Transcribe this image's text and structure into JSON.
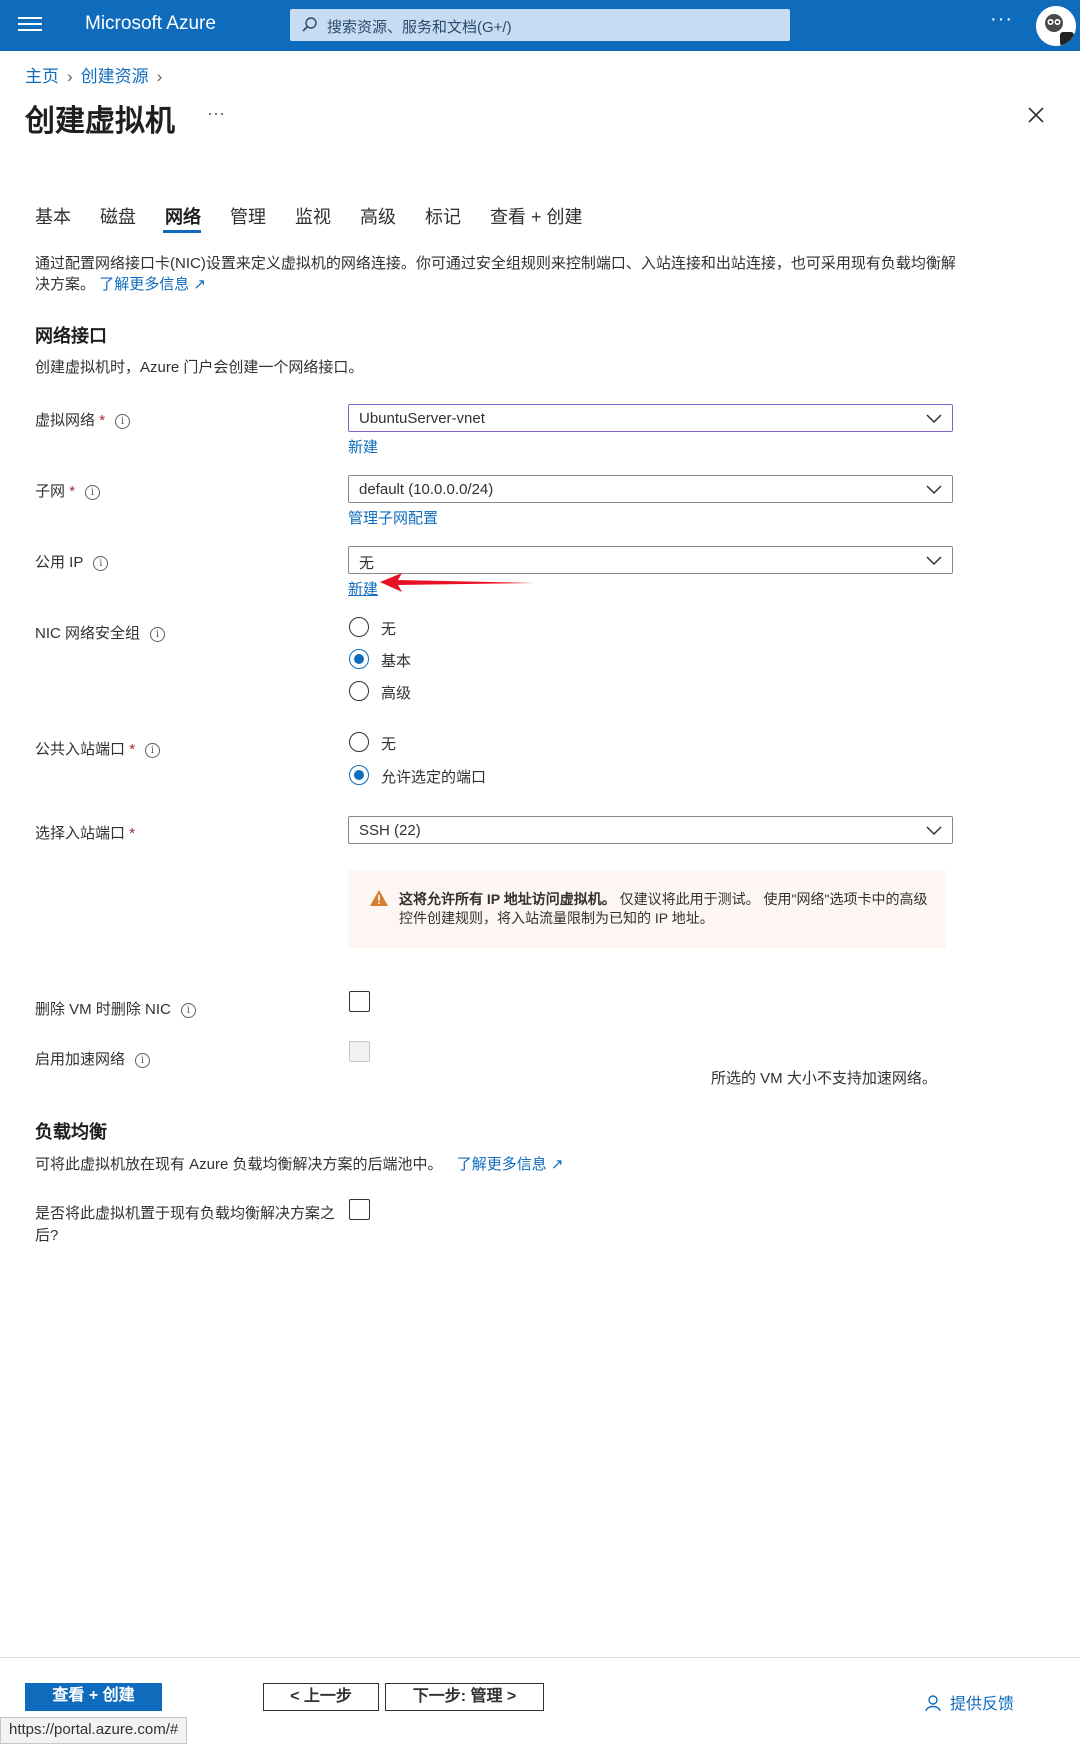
{
  "app": {
    "brand": "Microsoft Azure",
    "search_placeholder": "搜索资源、服务和文档(G+/)",
    "more": "···"
  },
  "breadcrumb": {
    "home": "主页",
    "create_resource": "创建资源"
  },
  "page": {
    "title": "创建虚拟机",
    "more": "···"
  },
  "tabs": [
    "基本",
    "磁盘",
    "网络",
    "管理",
    "监视",
    "高级",
    "标记",
    "查看 + 创建"
  ],
  "active_tab": "网络",
  "intro": {
    "text": "通过配置网络接口卡(NIC)设置来定义虚拟机的网络连接。你可通过安全组规则来控制端口、入站连接和出站连接，也可采用现有负载均衡解决方案。",
    "learn_more": "了解更多信息"
  },
  "nic_section": {
    "heading": "网络接口",
    "description": "创建虚拟机时，Azure 门户会创建一个网络接口。"
  },
  "fields": {
    "vnet": {
      "label": "虚拟网络",
      "value": "UbuntuServer-vnet",
      "link": "新建"
    },
    "subnet": {
      "label": "子网",
      "value": "default (10.0.0.0/24)",
      "link": "管理子网配置"
    },
    "public_ip": {
      "label": "公用 IP",
      "value": "无",
      "link": "新建"
    },
    "nic_nsg": {
      "label": "NIC 网络安全组",
      "options": [
        "无",
        "基本",
        "高级"
      ],
      "selected": "基本"
    },
    "public_inbound": {
      "label": "公共入站端口",
      "options": [
        "无",
        "允许选定的端口"
      ],
      "selected": "允许选定的端口"
    },
    "inbound_ports": {
      "label": "选择入站端口",
      "value": "SSH (22)"
    },
    "delete_nic": {
      "label": "删除 VM 时删除 NIC",
      "checked": false
    },
    "accel_net": {
      "label": "启用加速网络",
      "checked": false,
      "disabled": true,
      "note": "所选的 VM 大小不支持加速网络。"
    }
  },
  "warning": {
    "bold": "这将允许所有 IP 地址访问虚拟机。",
    "text": " 仅建议将此用于测试。 使用\"网络\"选项卡中的高级控件创建规则，将入站流量限制为已知的 IP 地址。"
  },
  "lb_section": {
    "heading": "负载均衡",
    "description": "可将此虚拟机放在现有 Azure 负载均衡解决方案的后端池中。",
    "learn_more": "了解更多信息",
    "question": "是否将此虚拟机置于现有负载均衡解决方案之后?",
    "checked": false
  },
  "footer": {
    "review_create": "查看 + 创建",
    "previous": "< 上一步",
    "next": "下一步: 管理 >",
    "feedback": "提供反馈",
    "status_url": "https://portal.azure.com/#"
  },
  "colors": {
    "accent": "#0f6cbd",
    "required": "#a4262c",
    "warning_icon": "#d67f2c",
    "annotation_arrow": "#e81123"
  }
}
